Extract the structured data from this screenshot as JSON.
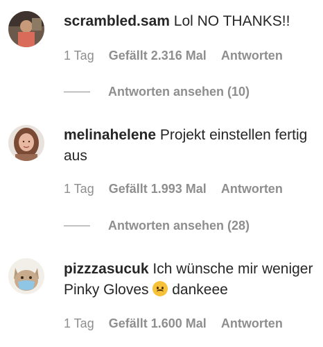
{
  "comments": [
    {
      "username": "scrambled.sam",
      "text": "Lol NO THANKS!!",
      "time": "1 Tag",
      "likes": "Gefällt 2.316 Mal",
      "reply": "Antworten",
      "view_replies": "Antworten ansehen (10)",
      "avatar_icon": "user-avatar-sam"
    },
    {
      "username": "melinahelene",
      "text": "Projekt einstellen fertig aus",
      "time": "1 Tag",
      "likes": "Gefällt 1.993 Mal",
      "reply": "Antworten",
      "view_replies": "Antworten ansehen (28)",
      "avatar_icon": "user-avatar-melina"
    },
    {
      "username": "pizzzasucuk",
      "text_before": "Ich wünsche mir weniger Pinky Gloves",
      "emoji": "upside-down-face-emoji",
      "text_after": "dankeee",
      "time": "1 Tag",
      "likes": "Gefällt 1.600 Mal",
      "reply": "Antworten",
      "avatar_icon": "user-avatar-cat"
    }
  ]
}
